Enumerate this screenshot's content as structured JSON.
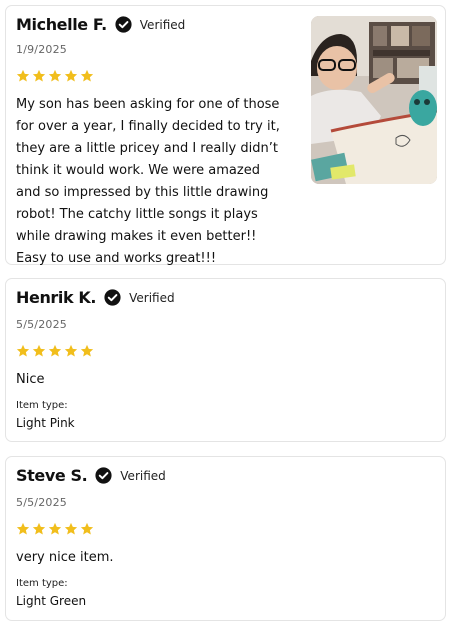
{
  "reviews": [
    {
      "name": "Michelle F.",
      "verified_label": "Verified",
      "date": "1/9/2025",
      "rating": 5,
      "text_lines": [
        "My son has been asking for one of those",
        "for over a year, I finally decided to try it,",
        "they are a little pricey and I really didn’t",
        "think it would work. We were amazed",
        "and so impressed by this little drawing",
        "robot! The catchy little songs it plays",
        "while drawing makes it even better!!",
        "Easy to use and works great!!!"
      ]
    },
    {
      "name": "Henrik K.",
      "verified_label": "Verified",
      "date": "5/5/2025",
      "rating": 5,
      "text": "Nice",
      "item_type_label": "Item type:",
      "item_type_value": "Light Pink"
    },
    {
      "name": "Steve S.",
      "verified_label": "Verified",
      "date": "5/5/2025",
      "rating": 5,
      "text": "very nice item.",
      "item_type_label": "Item type:",
      "item_type_value": "Light Green"
    }
  ],
  "colors": {
    "star": "#f1be1c",
    "badge": "#111111",
    "border": "#e4e4e4"
  }
}
